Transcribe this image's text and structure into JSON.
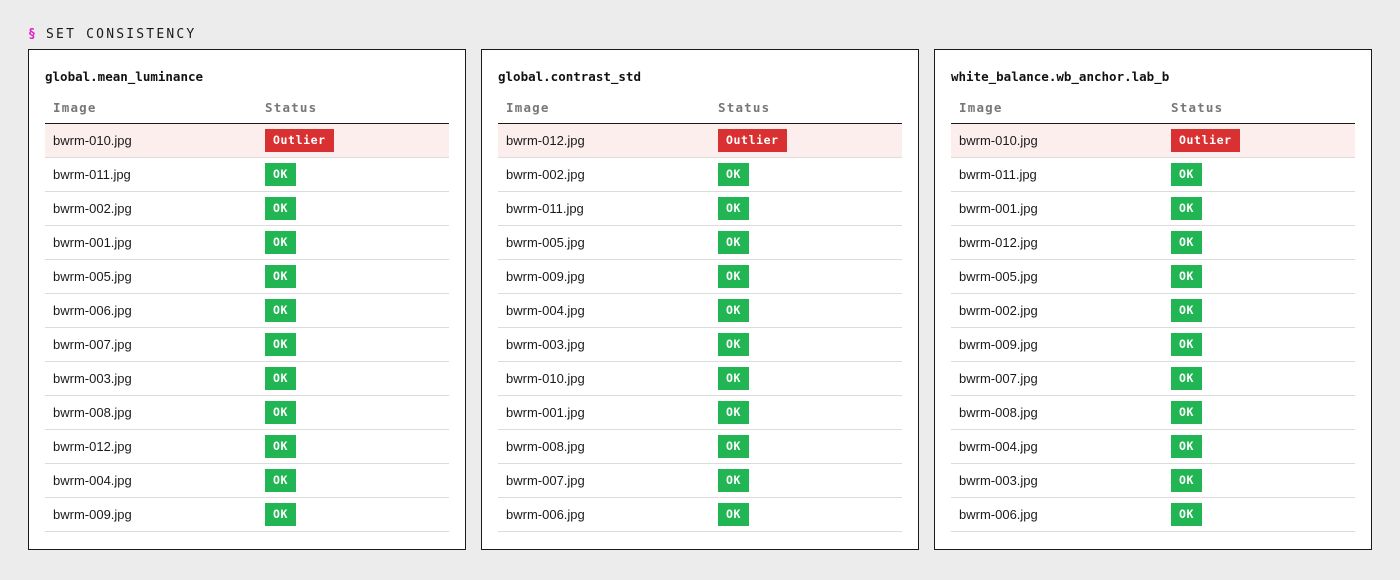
{
  "section": {
    "symbol": "§",
    "title": "SET CONSISTENCY"
  },
  "columns": {
    "image": "Image",
    "status": "Status"
  },
  "colors": {
    "ok": "#22b554",
    "outlier": "#d93131",
    "outlier_row": "#fdeeee",
    "section_symbol": "#e021c8"
  },
  "panels": [
    {
      "title": "global.mean_luminance",
      "rows": [
        {
          "image": "bwrm-010.jpg",
          "status": "Outlier"
        },
        {
          "image": "bwrm-011.jpg",
          "status": "OK"
        },
        {
          "image": "bwrm-002.jpg",
          "status": "OK"
        },
        {
          "image": "bwrm-001.jpg",
          "status": "OK"
        },
        {
          "image": "bwrm-005.jpg",
          "status": "OK"
        },
        {
          "image": "bwrm-006.jpg",
          "status": "OK"
        },
        {
          "image": "bwrm-007.jpg",
          "status": "OK"
        },
        {
          "image": "bwrm-003.jpg",
          "status": "OK"
        },
        {
          "image": "bwrm-008.jpg",
          "status": "OK"
        },
        {
          "image": "bwrm-012.jpg",
          "status": "OK"
        },
        {
          "image": "bwrm-004.jpg",
          "status": "OK"
        },
        {
          "image": "bwrm-009.jpg",
          "status": "OK"
        }
      ]
    },
    {
      "title": "global.contrast_std",
      "rows": [
        {
          "image": "bwrm-012.jpg",
          "status": "Outlier"
        },
        {
          "image": "bwrm-002.jpg",
          "status": "OK"
        },
        {
          "image": "bwrm-011.jpg",
          "status": "OK"
        },
        {
          "image": "bwrm-005.jpg",
          "status": "OK"
        },
        {
          "image": "bwrm-009.jpg",
          "status": "OK"
        },
        {
          "image": "bwrm-004.jpg",
          "status": "OK"
        },
        {
          "image": "bwrm-003.jpg",
          "status": "OK"
        },
        {
          "image": "bwrm-010.jpg",
          "status": "OK"
        },
        {
          "image": "bwrm-001.jpg",
          "status": "OK"
        },
        {
          "image": "bwrm-008.jpg",
          "status": "OK"
        },
        {
          "image": "bwrm-007.jpg",
          "status": "OK"
        },
        {
          "image": "bwrm-006.jpg",
          "status": "OK"
        }
      ]
    },
    {
      "title": "white_balance.wb_anchor.lab_b",
      "rows": [
        {
          "image": "bwrm-010.jpg",
          "status": "Outlier"
        },
        {
          "image": "bwrm-011.jpg",
          "status": "OK"
        },
        {
          "image": "bwrm-001.jpg",
          "status": "OK"
        },
        {
          "image": "bwrm-012.jpg",
          "status": "OK"
        },
        {
          "image": "bwrm-005.jpg",
          "status": "OK"
        },
        {
          "image": "bwrm-002.jpg",
          "status": "OK"
        },
        {
          "image": "bwrm-009.jpg",
          "status": "OK"
        },
        {
          "image": "bwrm-007.jpg",
          "status": "OK"
        },
        {
          "image": "bwrm-008.jpg",
          "status": "OK"
        },
        {
          "image": "bwrm-004.jpg",
          "status": "OK"
        },
        {
          "image": "bwrm-003.jpg",
          "status": "OK"
        },
        {
          "image": "bwrm-006.jpg",
          "status": "OK"
        }
      ]
    }
  ]
}
